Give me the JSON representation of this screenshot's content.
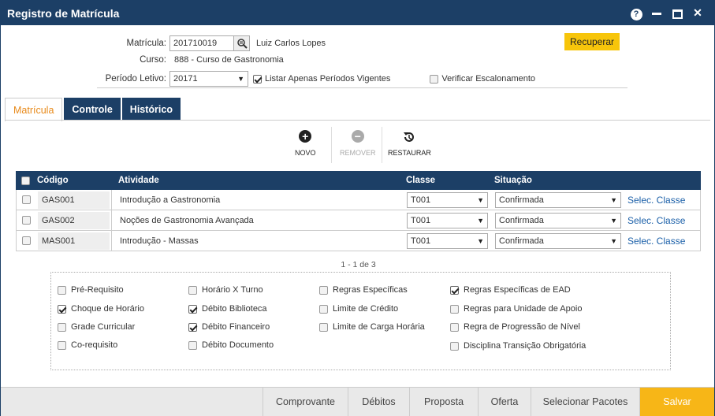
{
  "window": {
    "title": "Registro de Matrícula",
    "help": "?",
    "close": "✕"
  },
  "header": {
    "matricula_label": "Matrícula:",
    "matricula_value": "201710019",
    "student_name": "Luiz Carlos Lopes",
    "curso_label": "Curso:",
    "curso_value": "888 - Curso de Gastronomia",
    "periodo_label": "Período Letivo:",
    "periodo_value": "20171",
    "listar_label": "Listar Apenas Períodos Vigentes",
    "listar_checked": true,
    "verificar_label": "Verificar Escalonamento",
    "verificar_checked": false,
    "recuperar_label": "Recuperar"
  },
  "tabs": [
    {
      "label": "Matrícula"
    },
    {
      "label": "Controle"
    },
    {
      "label": "Histórico"
    }
  ],
  "actions": {
    "novo": "NOVO",
    "remover": "REMOVER",
    "restaurar": "RESTAURAR"
  },
  "grid": {
    "headers": {
      "codigo": "Código",
      "atividade": "Atividade",
      "classe": "Classe",
      "situacao": "Situação"
    },
    "rows": [
      {
        "codigo": "GAS001",
        "atividade": "Introdução a Gastronomia",
        "classe": "T001",
        "situacao": "Confirmada",
        "link": "Selec. Classe"
      },
      {
        "codigo": "GAS002",
        "atividade": "Noções de Gastronomia Avançada",
        "classe": "T001",
        "situacao": "Confirmada",
        "link": "Selec. Classe"
      },
      {
        "codigo": "MAS001",
        "atividade": "Introdução - Massas",
        "classe": "T001",
        "situacao": "Confirmada",
        "link": "Selec. Classe"
      }
    ],
    "pager": "1 - 1 de 3"
  },
  "checks": {
    "c1": [
      {
        "label": "Pré-Requisito",
        "checked": false
      },
      {
        "label": "Choque de Horário",
        "checked": true
      },
      {
        "label": "Grade Curricular",
        "checked": false
      },
      {
        "label": "Co-requisito",
        "checked": false
      }
    ],
    "c2": [
      {
        "label": "Horário X Turno",
        "checked": false
      },
      {
        "label": "Débito Biblioteca",
        "checked": true
      },
      {
        "label": "Débito Financeiro",
        "checked": true
      },
      {
        "label": "Débito Documento",
        "checked": false
      }
    ],
    "c3": [
      {
        "label": "Regras Específicas",
        "checked": false
      },
      {
        "label": "Limite de Crédito",
        "checked": false
      },
      {
        "label": "Limite de Carga Horária",
        "checked": false
      }
    ],
    "c4": [
      {
        "label": "Regras Específicas de EAD",
        "checked": true
      },
      {
        "label": "Regras para Unidade de Apoio",
        "checked": false
      },
      {
        "label": "Regra de Progressão de Nível",
        "checked": false
      },
      {
        "label": "Disciplina Transição Obrigatória",
        "checked": false
      }
    ]
  },
  "footer": {
    "comprovante": "Comprovante",
    "debitos": "Débitos",
    "proposta": "Proposta",
    "oferta": "Oferta",
    "selecionar": "Selecionar Pacotes",
    "salvar": "Salvar"
  },
  "colors": {
    "navy": "#1c3f66",
    "accent": "#f7b617",
    "tab_active": "#e88a1a",
    "link": "#1a5fa8"
  }
}
